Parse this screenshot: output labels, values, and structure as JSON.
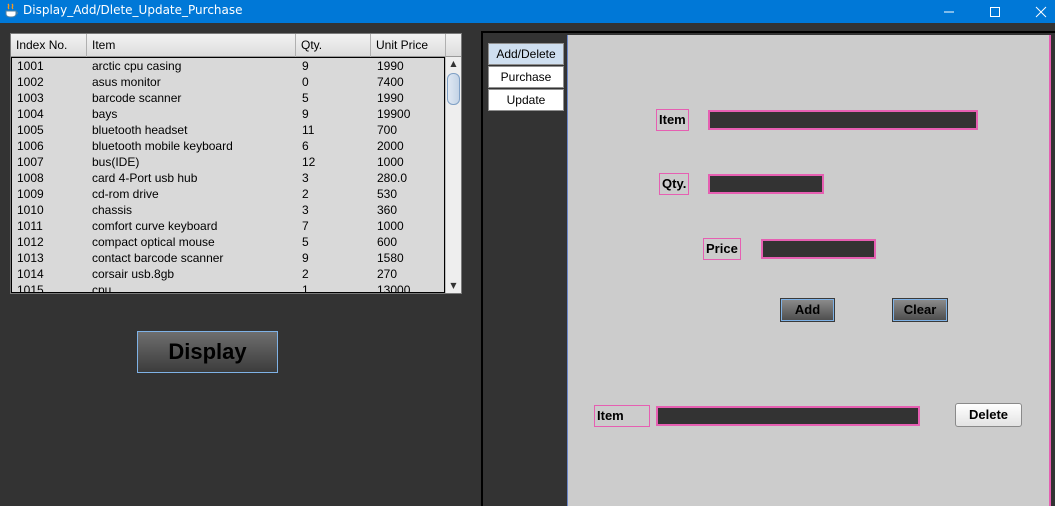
{
  "window": {
    "title": "Display_Add/Dlete_Update_Purchase"
  },
  "table": {
    "columns": [
      "Index No.",
      "Item",
      "Qty.",
      "Unit Price"
    ],
    "rows": [
      [
        "1001",
        "arctic cpu casing",
        " 9",
        "1990"
      ],
      [
        "1002",
        "asus monitor",
        "0",
        "  7400"
      ],
      [
        "1003",
        "barcode scanner",
        "5",
        " 1990"
      ],
      [
        "1004",
        "bays",
        "9",
        "19900"
      ],
      [
        "1005",
        "bluetooth headset",
        "11",
        "700"
      ],
      [
        "1006",
        "bluetooth mobile keyboard",
        "6",
        "  2000"
      ],
      [
        "1007",
        "bus(IDE)",
        "12",
        " 1000"
      ],
      [
        "1008",
        "card 4-Port usb hub",
        "3",
        "280.0"
      ],
      [
        "1009",
        "cd-rom drive",
        "2",
        "  530"
      ],
      [
        "1010",
        "chassis",
        "3",
        "  360"
      ],
      [
        "1011",
        "comfort curve keyboard",
        "7",
        "  1000"
      ],
      [
        "1012",
        "compact optical mouse",
        "5",
        "  600"
      ],
      [
        "1013",
        "contact barcode scanner",
        "9",
        "1580"
      ],
      [
        "1014",
        "corsair usb.8gb",
        "2",
        "  270"
      ],
      [
        "1015",
        "cpu",
        "1",
        "13000"
      ]
    ]
  },
  "display_button": "Display",
  "tabs": [
    {
      "label": "Add/Delete",
      "selected": true
    },
    {
      "label": "Purchase",
      "selected": false
    },
    {
      "label": "Update",
      "selected": false
    }
  ],
  "form": {
    "item_label": "Item",
    "item_value": "",
    "qty_label": "Qty.",
    "qty_value": "",
    "price_label": "Price",
    "price_value": "",
    "add_button": "Add",
    "clear_button": "Clear",
    "delete_item_label": "Item",
    "delete_item_value": "",
    "delete_button": "Delete"
  },
  "colors": {
    "titlebar": "#0078d7",
    "background": "#333333",
    "form_background": "#cccccc",
    "accent_border": "#e65fb2",
    "button_border": "#7fb2e6"
  }
}
